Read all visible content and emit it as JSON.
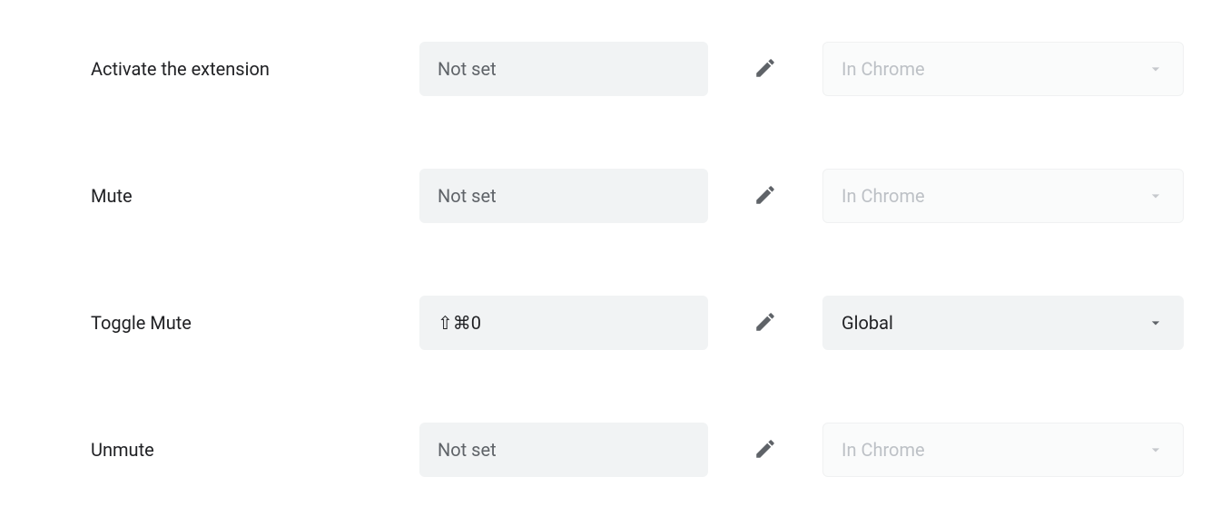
{
  "shortcut_placeholder": "Not set",
  "rows": [
    {
      "label": "Activate the extension",
      "shortcut": "",
      "scope": "In Chrome",
      "scope_enabled": false
    },
    {
      "label": "Mute",
      "shortcut": "",
      "scope": "In Chrome",
      "scope_enabled": false
    },
    {
      "label": "Toggle Mute",
      "shortcut": "⇧⌘0",
      "scope": "Global",
      "scope_enabled": true
    },
    {
      "label": "Unmute",
      "shortcut": "",
      "scope": "In Chrome",
      "scope_enabled": false
    }
  ]
}
